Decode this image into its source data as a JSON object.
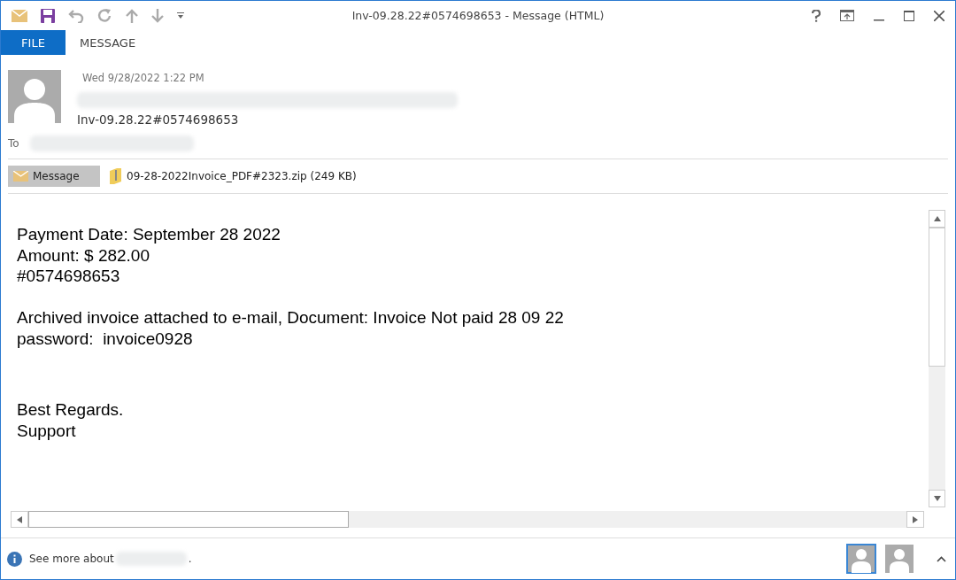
{
  "window": {
    "title": "Inv-09.28.22#0574698653 - Message (HTML)"
  },
  "tabs": [
    {
      "label": "FILE",
      "selected": true
    },
    {
      "label": "MESSAGE",
      "selected": false
    }
  ],
  "header": {
    "date": "Wed 9/28/2022 1:22 PM",
    "subject": "Inv-09.28.22#0574698653",
    "to_label": "To"
  },
  "attachments": [
    {
      "kind": "message",
      "label": "Message",
      "selected": true
    },
    {
      "kind": "file",
      "label": "09-28-2022Invoice_PDF#2323.zip (249 KB)",
      "selected": false
    }
  ],
  "body": {
    "paragraphs": [
      [
        "Payment Date: September 28 2022",
        "Amount: $ 282.00",
        "#0574698653"
      ],
      [
        "Archived invoice attached to e-mail, Document: Invoice Not paid 28 09 22",
        "password:  invoice0928"
      ],
      [
        "Best Regards.",
        "Support"
      ]
    ]
  },
  "people_pane": {
    "prefix": "See more about",
    "suffix": "."
  }
}
